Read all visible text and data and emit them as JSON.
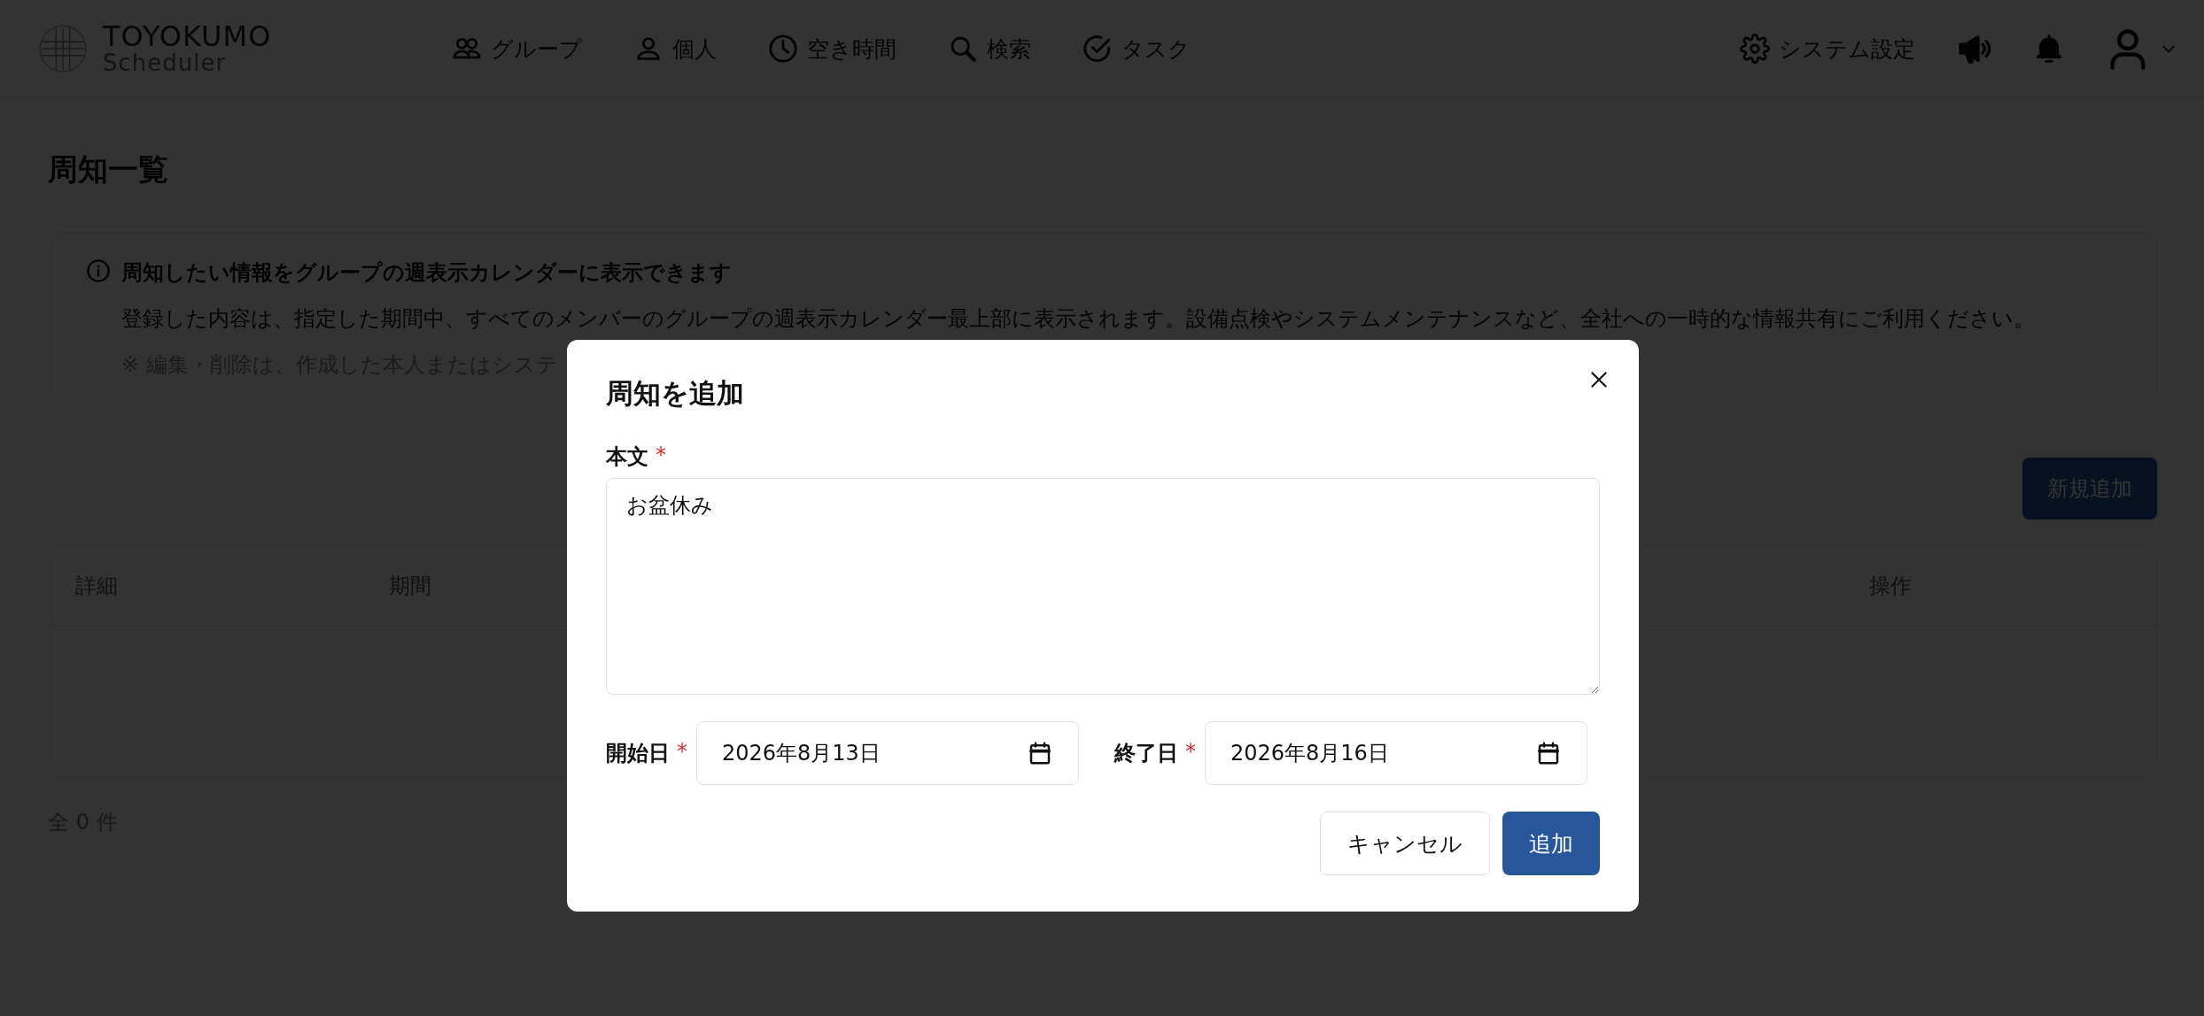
{
  "header": {
    "logo": {
      "name": "TOYOKUMO",
      "sub": "Scheduler"
    },
    "nav": [
      {
        "kind": "group",
        "label": "グループ"
      },
      {
        "kind": "person",
        "label": "個人"
      },
      {
        "kind": "clock",
        "label": "空き時間"
      },
      {
        "kind": "search",
        "label": "検索"
      },
      {
        "kind": "task",
        "label": "タスク"
      }
    ],
    "settings": {
      "label": "システム設定"
    }
  },
  "page_title": "周知一覧",
  "info": {
    "heading": "周知したい情報をグループの週表示カレンダーに表示できます",
    "body": "登録した内容は、指定した期間中、すべてのメンバーのグループの週表示カレンダー最上部に表示されます。設備点検やシステムメンテナンスなど、全社への一時的な情報共有にご利用ください。",
    "note": "※ 編集・削除は、作成した本人またはシステ"
  },
  "new_button": "新規追加",
  "table": {
    "columns": [
      {
        "label": "詳細"
      },
      {
        "label": "期間"
      },
      {
        "label": "操作"
      }
    ]
  },
  "count": "全 0 件",
  "modal": {
    "title": "周知を追加",
    "body_field": {
      "label": "本文",
      "required_mark": "*",
      "value": "お盆休み"
    },
    "start_field": {
      "label": "開始日",
      "required_mark": "*",
      "value": "2026年8月13日"
    },
    "end_field": {
      "label": "終了日",
      "required_mark": "*",
      "value": "2026年8月16日"
    },
    "buttons": [
      {
        "label": "キャンセル",
        "kind": "secondary"
      },
      {
        "label": "追加",
        "kind": "primary"
      }
    ]
  }
}
